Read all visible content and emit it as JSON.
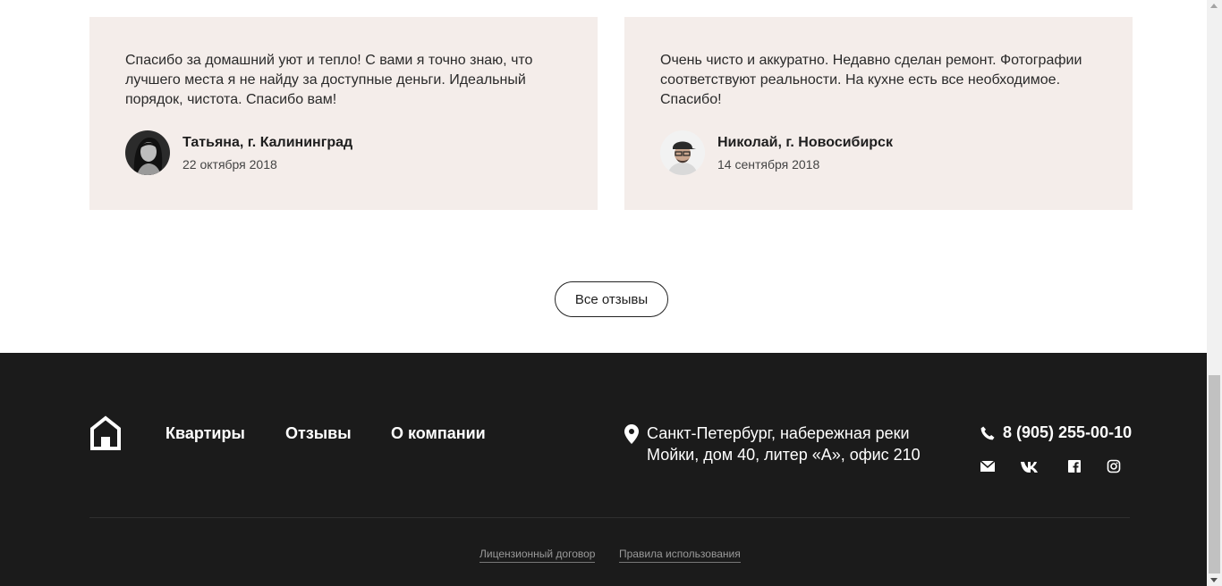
{
  "reviews": [
    {
      "text": "Спасибо за домашний уют и тепло! С вами я точно знаю, что лучшего места я не найду за доступные деньги. Идеальный порядок, чистота. Спасибо вам!",
      "author": "Татьяна, г. Калининград",
      "date": "22 октября 2018",
      "avatar_icon": "woman-portrait"
    },
    {
      "text": "Очень чисто и аккуратно. Недавно сделан ремонт. Фотографии соответствуют реальности. На кухне есть все необходимое. Спасибо!",
      "author": "Николай, г. Новосибирск",
      "date": "14 сентября 2018",
      "avatar_icon": "man-portrait"
    }
  ],
  "all_reviews_button": "Все отзывы",
  "footer": {
    "logo_icon": "house-icon",
    "nav": [
      "Квартиры",
      "Отзывы",
      "О компании"
    ],
    "address_icon": "location-pin-icon",
    "address_line1": "Санкт-Петербург, набережная реки",
    "address_line2": "Мойки, дом 40, литер «А», офис 210",
    "phone_icon": "phone-icon",
    "phone": "8 (905) 255-00-10",
    "social": [
      "mail-icon",
      "vk-icon",
      "facebook-icon",
      "instagram-icon"
    ],
    "legal": [
      "Лицензионный договор",
      "Правила использования"
    ]
  },
  "colors": {
    "card_bg": "#f4edea",
    "footer_bg": "#1b1b1b",
    "text": "#222222"
  }
}
